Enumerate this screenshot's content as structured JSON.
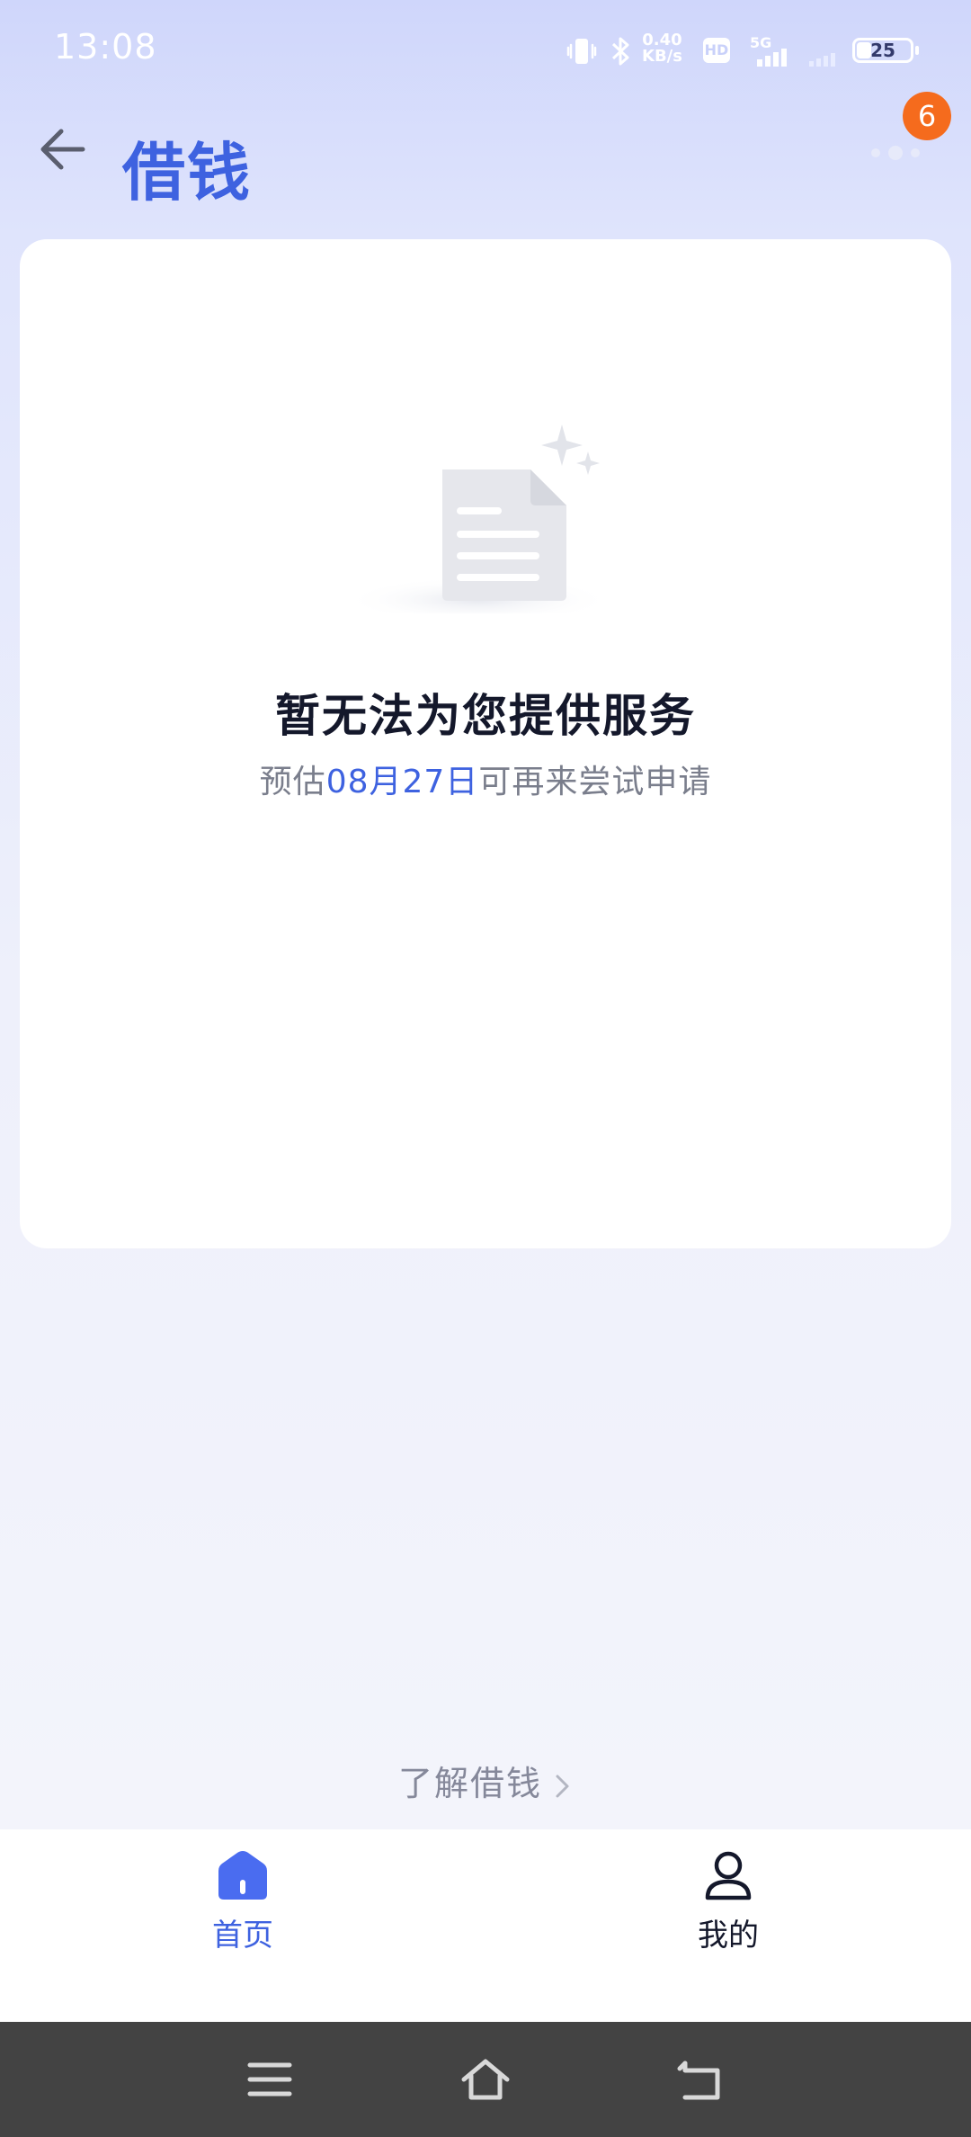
{
  "status_bar": {
    "time": "13:08",
    "net_speed_value": "0.40",
    "net_speed_unit": "KB/s",
    "hd_label": "HD",
    "network": "5G",
    "battery": "25",
    "battery_level": 0.25
  },
  "header": {
    "title": "借钱",
    "notification_count": "6"
  },
  "card": {
    "empty_title": "暂无法为您提供服务",
    "empty_sub_prefix": "预估",
    "empty_sub_date": "08月27日",
    "empty_sub_suffix": "可再来尝试申请"
  },
  "learn_link": "了解借钱",
  "tabbar": {
    "home_label": "首页",
    "mine_label": "我的"
  },
  "colors": {
    "accent": "#3e62e0",
    "badge": "#f56b1d"
  },
  "icons": {
    "back": "back-arrow-icon",
    "menu": "more-dots-icon",
    "home": "home-icon",
    "mine": "user-icon"
  }
}
